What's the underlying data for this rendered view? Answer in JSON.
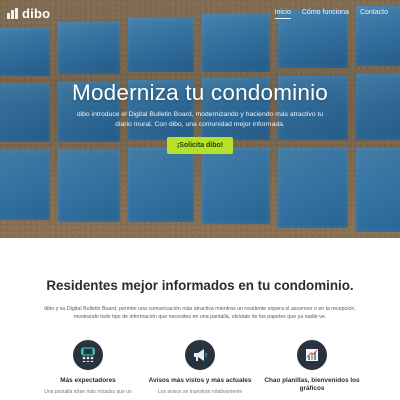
{
  "brand": {
    "name": "dibo"
  },
  "nav": {
    "items": [
      {
        "label": "Inicio",
        "active": true
      },
      {
        "label": "Cómo funciona",
        "active": false
      },
      {
        "label": "Contacto",
        "active": false
      }
    ]
  },
  "hero": {
    "title": "Moderniza tu condominio",
    "text": "dibo introduce el Digital Bulletin Board, modernizando y haciendo más atractivo tu diario mural. Con dibo, una comunidad mejor informada.",
    "cta_label": "¡Solicita dibo!"
  },
  "section": {
    "title": "Residentes mejor informados en tu condominio.",
    "text": "dibo y su Digital Bulletin Board, permite una comunicación más atractiva mientras un residente espera el ascensor o en la recepción, mostrando todo tipo de información que necesites en una pantalla, olvídate de los papeles que ya nadie ve."
  },
  "features": [
    {
      "label": "Más expectadores",
      "icon": "audience-icon",
      "desc": "Una pantalla atrae más miradas que un"
    },
    {
      "label": "Avisos más vistos y más actuales",
      "icon": "megaphone-icon",
      "desc": "Los avisos se muestran rotativamente"
    },
    {
      "label": "Chao planillas, bienvenidos los gráficos",
      "icon": "chart-icon",
      "desc": ""
    }
  ],
  "colors": {
    "accent_green": "#b6e22b",
    "panel_blue": "#3e8ac4",
    "cork": "#a9865a",
    "icon_circle": "#27333f"
  }
}
